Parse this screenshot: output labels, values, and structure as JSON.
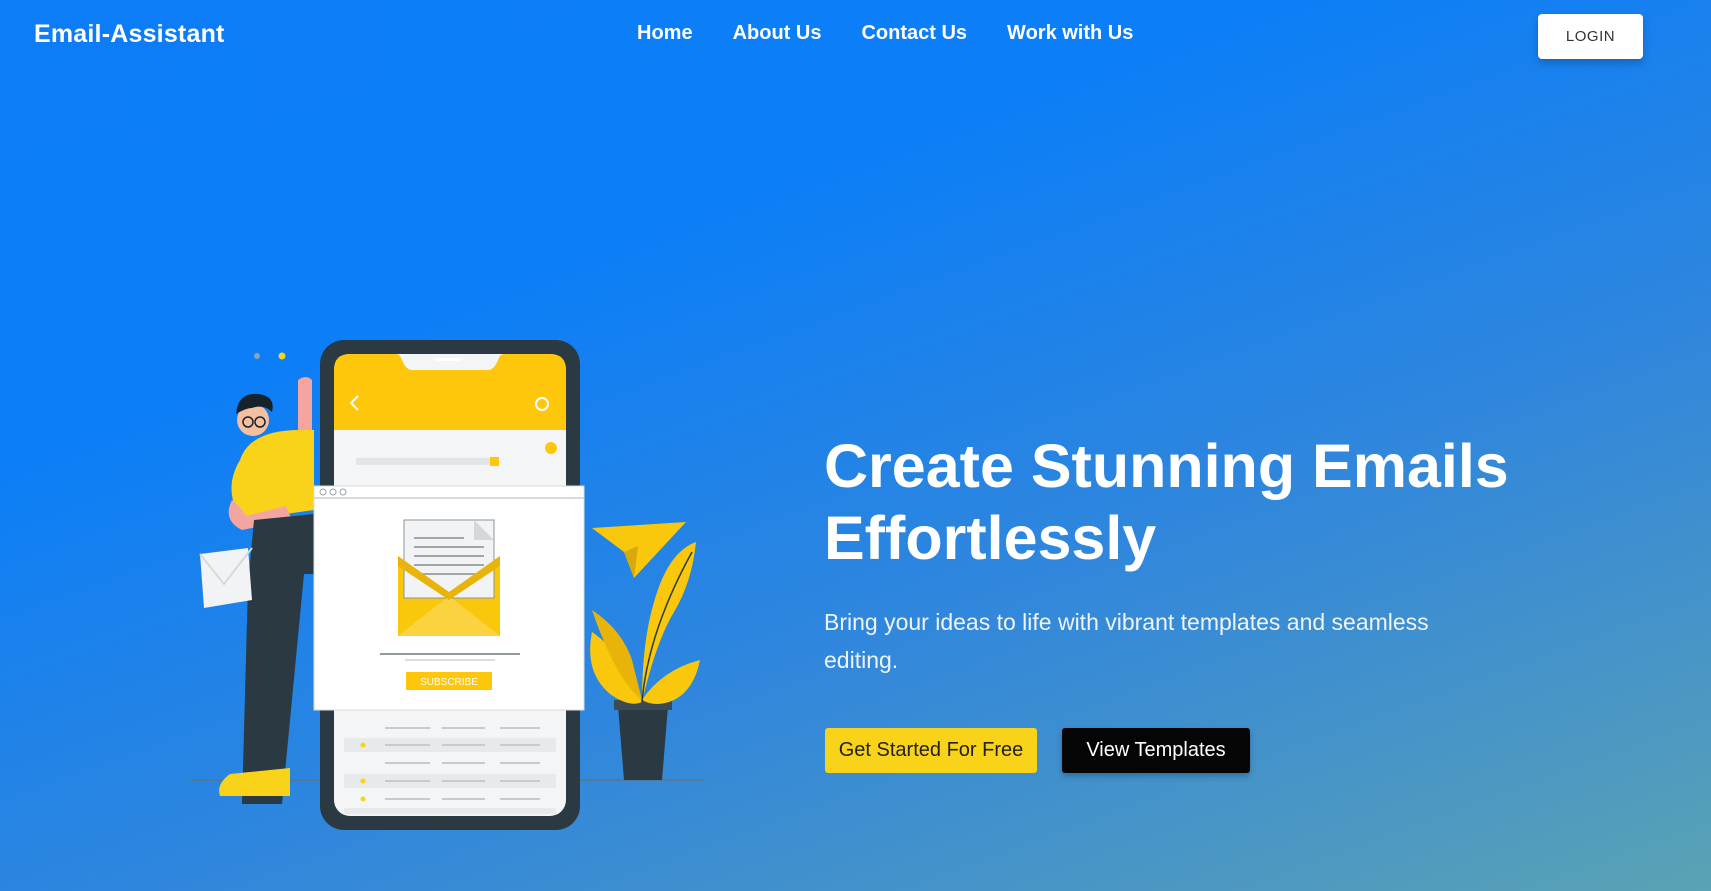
{
  "navbar": {
    "brand": "Email-Assistant",
    "links": [
      {
        "label": "Home"
      },
      {
        "label": "About Us"
      },
      {
        "label": "Contact Us"
      },
      {
        "label": "Work with Us"
      }
    ],
    "login_label": "LOGIN"
  },
  "hero": {
    "title": "Create Stunning Emails Effortlessly",
    "subtitle": "Bring your ideas to life with vibrant templates and seamless editing.",
    "primary_cta": "Get Started For Free",
    "secondary_cta": "View Templates"
  },
  "illustration": {
    "subscribe_label": "SUBSCRIBE",
    "icons": [
      "person-icon",
      "phone-icon",
      "envelope-icon",
      "paper-plane-icon",
      "plant-icon",
      "settings-icon"
    ]
  },
  "colors": {
    "accent_yellow": "#f9d21a",
    "dark": "#2b3a42",
    "background_start": "#0d7df7",
    "background_end": "#59a3b4"
  }
}
